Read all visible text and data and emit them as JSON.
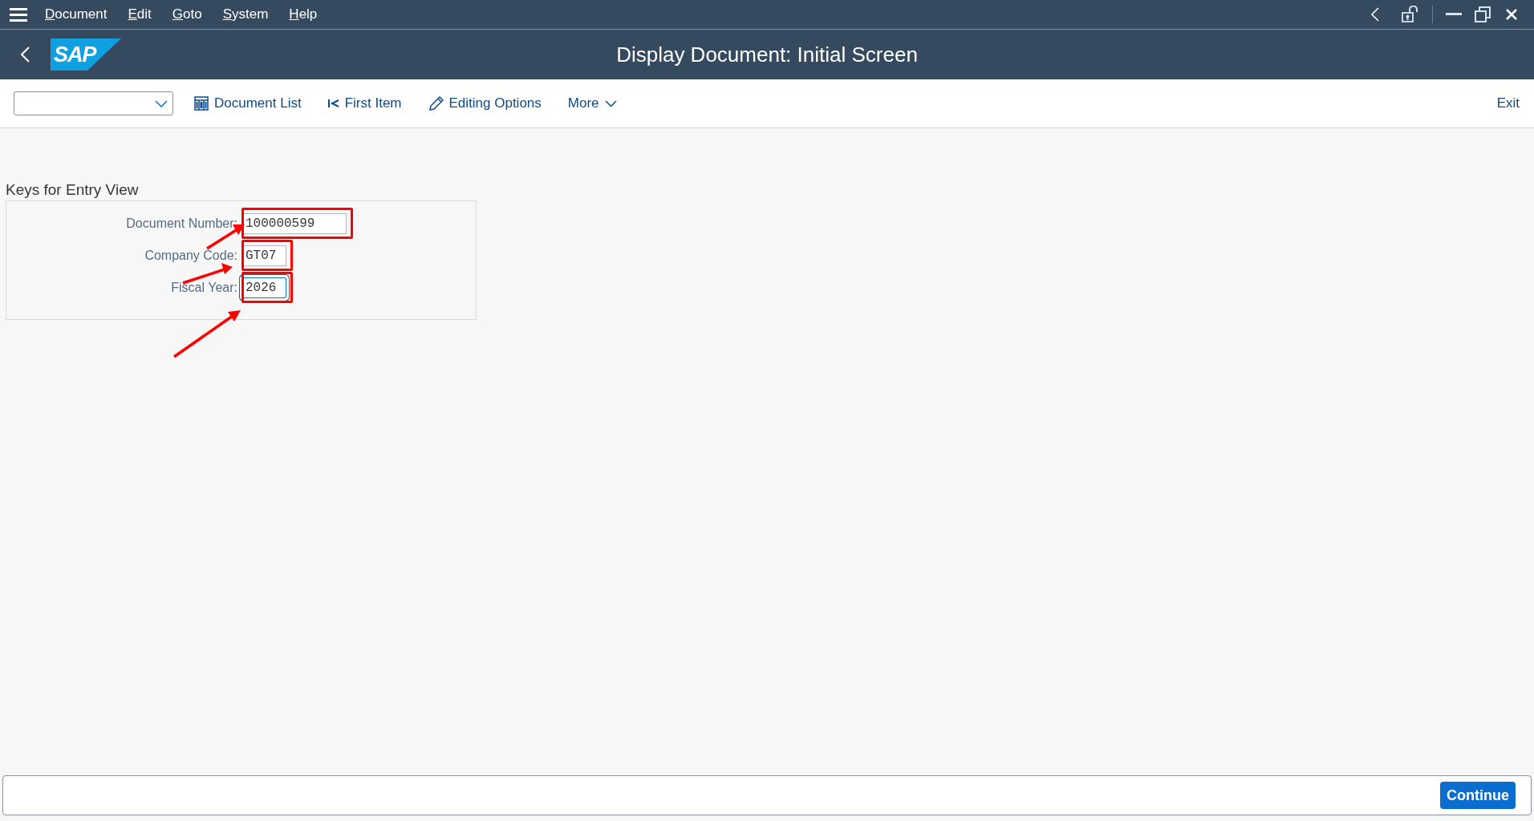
{
  "menu_bar": {
    "items": [
      {
        "label": "Document"
      },
      {
        "label": "Edit"
      },
      {
        "label": "Goto"
      },
      {
        "label": "System"
      },
      {
        "label": "Help"
      }
    ]
  },
  "title_bar": {
    "logo": "SAP",
    "title": "Display Document: Initial Screen"
  },
  "toolbar": {
    "buttons": [
      {
        "label": "Document List",
        "kind": "list"
      },
      {
        "label": "First Item",
        "kind": "first"
      },
      {
        "label": "Editing Options",
        "kind": "edit"
      },
      {
        "label": "More",
        "kind": "more"
      }
    ],
    "exit": "Exit"
  },
  "form": {
    "title": "Keys for Entry View",
    "fields": [
      {
        "label": "Document Number:",
        "value": "100000599",
        "focused": false,
        "highlighted": true
      },
      {
        "label": "Company Code:",
        "value": "GT07",
        "focused": false,
        "highlighted": true
      },
      {
        "label": "Fiscal Year:",
        "value": "2026",
        "focused": true,
        "highlighted": true
      }
    ]
  },
  "footer": {
    "button": "Continue"
  }
}
